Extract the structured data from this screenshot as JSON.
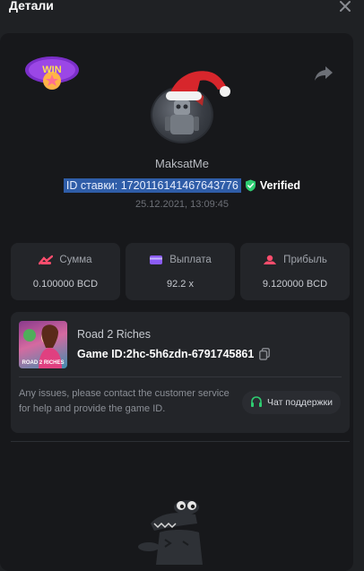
{
  "header": {
    "title": "Детали"
  },
  "bet": {
    "username": "MaksatMe",
    "bet_id": "ID ставки: 1720116141467643776",
    "verified_label": "Verified",
    "date": "25.12.2021, 13:09:45",
    "win_badge_text": "WIN"
  },
  "stats": [
    {
      "label": "Сумма",
      "value": "0.100000 BCD",
      "icon": "coins-icon"
    },
    {
      "label": "Выплата",
      "value": "92.2 x",
      "icon": "wallet-icon"
    },
    {
      "label": "Прибыль",
      "value": "9.120000 BCD",
      "icon": "profit-icon"
    }
  ],
  "game": {
    "name": "Road 2 Riches",
    "id_label": "Game ID:",
    "id_value": "2hc-5h6zdn-6791745861",
    "thumb_text": "ROAD 2 RICHES",
    "help_text": "Any issues, please contact the customer service for help and provide the game ID.",
    "support_label": "Чат поддержки"
  },
  "colors": {
    "background": "#1f2124",
    "panel": "#17181b",
    "card": "#232529",
    "verified_green": "#2ecc71",
    "selection_blue": "#2f5da8"
  }
}
